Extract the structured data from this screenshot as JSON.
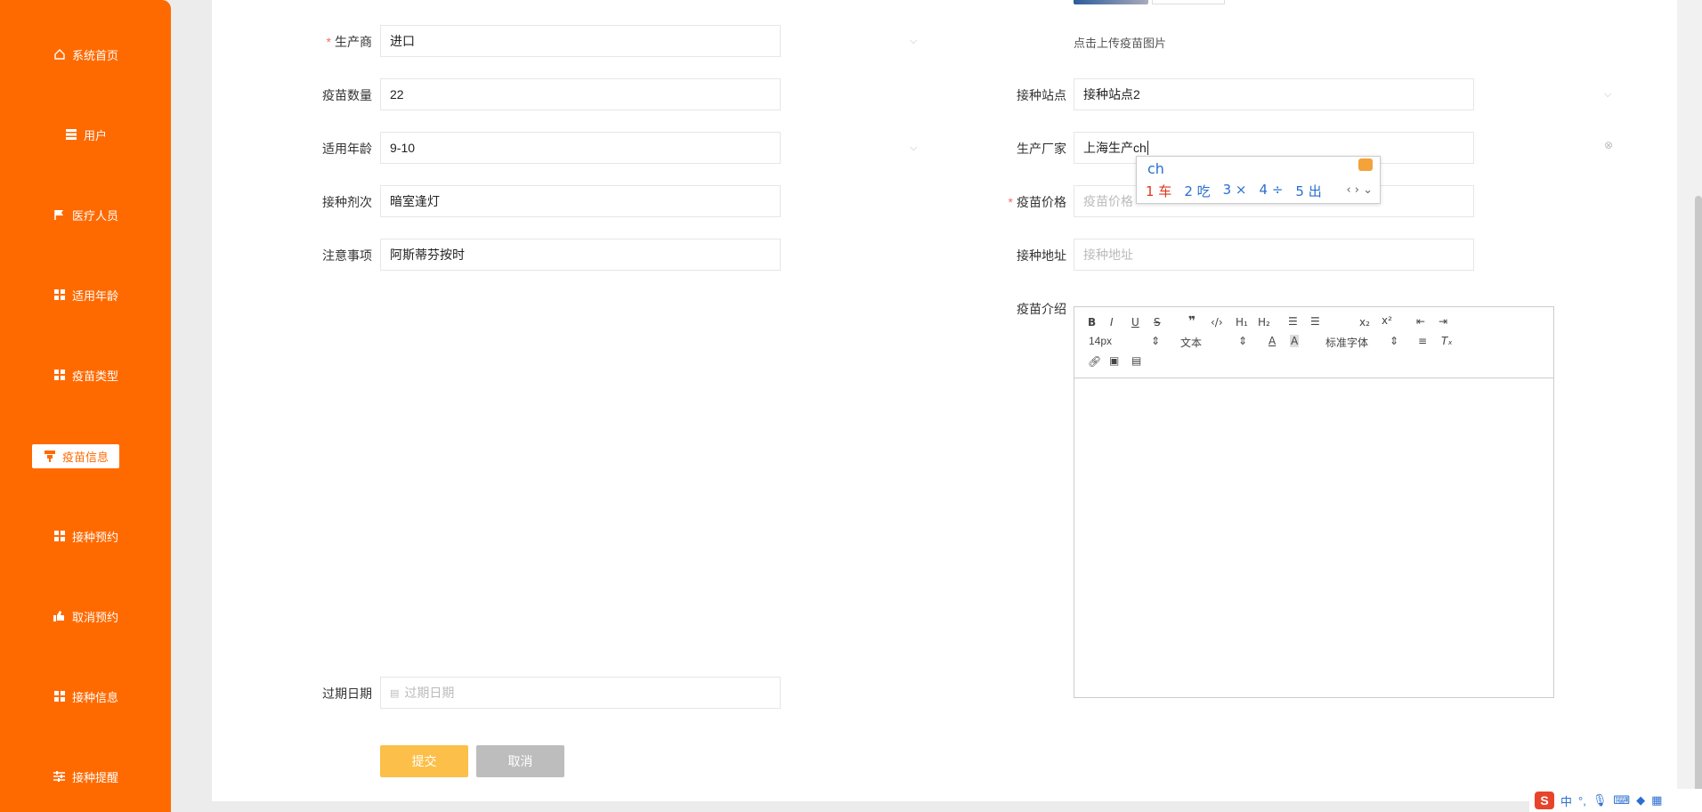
{
  "sidebar": {
    "items": [
      {
        "label": "系统首页",
        "icon": "home-icon"
      },
      {
        "label": "用户",
        "icon": "grid-icon"
      },
      {
        "label": "医疗人员",
        "icon": "flag-icon"
      },
      {
        "label": "适用年龄",
        "icon": "grid-icon"
      },
      {
        "label": "疫苗类型",
        "icon": "grid-icon"
      },
      {
        "label": "疫苗信息",
        "icon": "cup-icon",
        "active": true
      },
      {
        "label": "接种预约",
        "icon": "grid-icon"
      },
      {
        "label": "取消预约",
        "icon": "thumb-icon"
      },
      {
        "label": "接种信息",
        "icon": "grid-icon"
      },
      {
        "label": "接种提醒",
        "icon": "sliders-icon"
      }
    ]
  },
  "form": {
    "manufacturer": {
      "label": "生产商",
      "required": "*",
      "value": "进口"
    },
    "quantity": {
      "label": "疫苗数量",
      "value": "22"
    },
    "age": {
      "label": "适用年龄",
      "value": "9-10"
    },
    "dose": {
      "label": "接种剂次",
      "value": "暗室逢灯"
    },
    "notes": {
      "label": "注意事项",
      "value": "阿斯蒂芬按时"
    },
    "expiry": {
      "label": "过期日期",
      "placeholder": "过期日期"
    },
    "upload_hint": "点击上传疫苗图片",
    "site": {
      "label": "接种站点",
      "value": "接种站点2"
    },
    "factory": {
      "label": "生产厂家",
      "value": "上海生产ch"
    },
    "price": {
      "label": "疫苗价格",
      "required": "*",
      "placeholder": "疫苗价格"
    },
    "address": {
      "label": "接种地址",
      "placeholder": "接种地址"
    },
    "intro": {
      "label": "疫苗介绍"
    }
  },
  "editor": {
    "font_size": "14px",
    "paragraph": "文本",
    "font_family": "标准字体"
  },
  "buttons": {
    "submit": "提交",
    "cancel": "取消"
  },
  "ime": {
    "input": "ch",
    "candidates": [
      "1 车",
      "2 吃",
      "3 ×",
      "4 ÷",
      "5 出"
    ]
  },
  "tray": {
    "lang": "中",
    "punct": "°,"
  },
  "colors": {
    "sidebar": "#ff6a00",
    "submit": "#fcbf4a",
    "cancel": "#bdbdbd"
  }
}
